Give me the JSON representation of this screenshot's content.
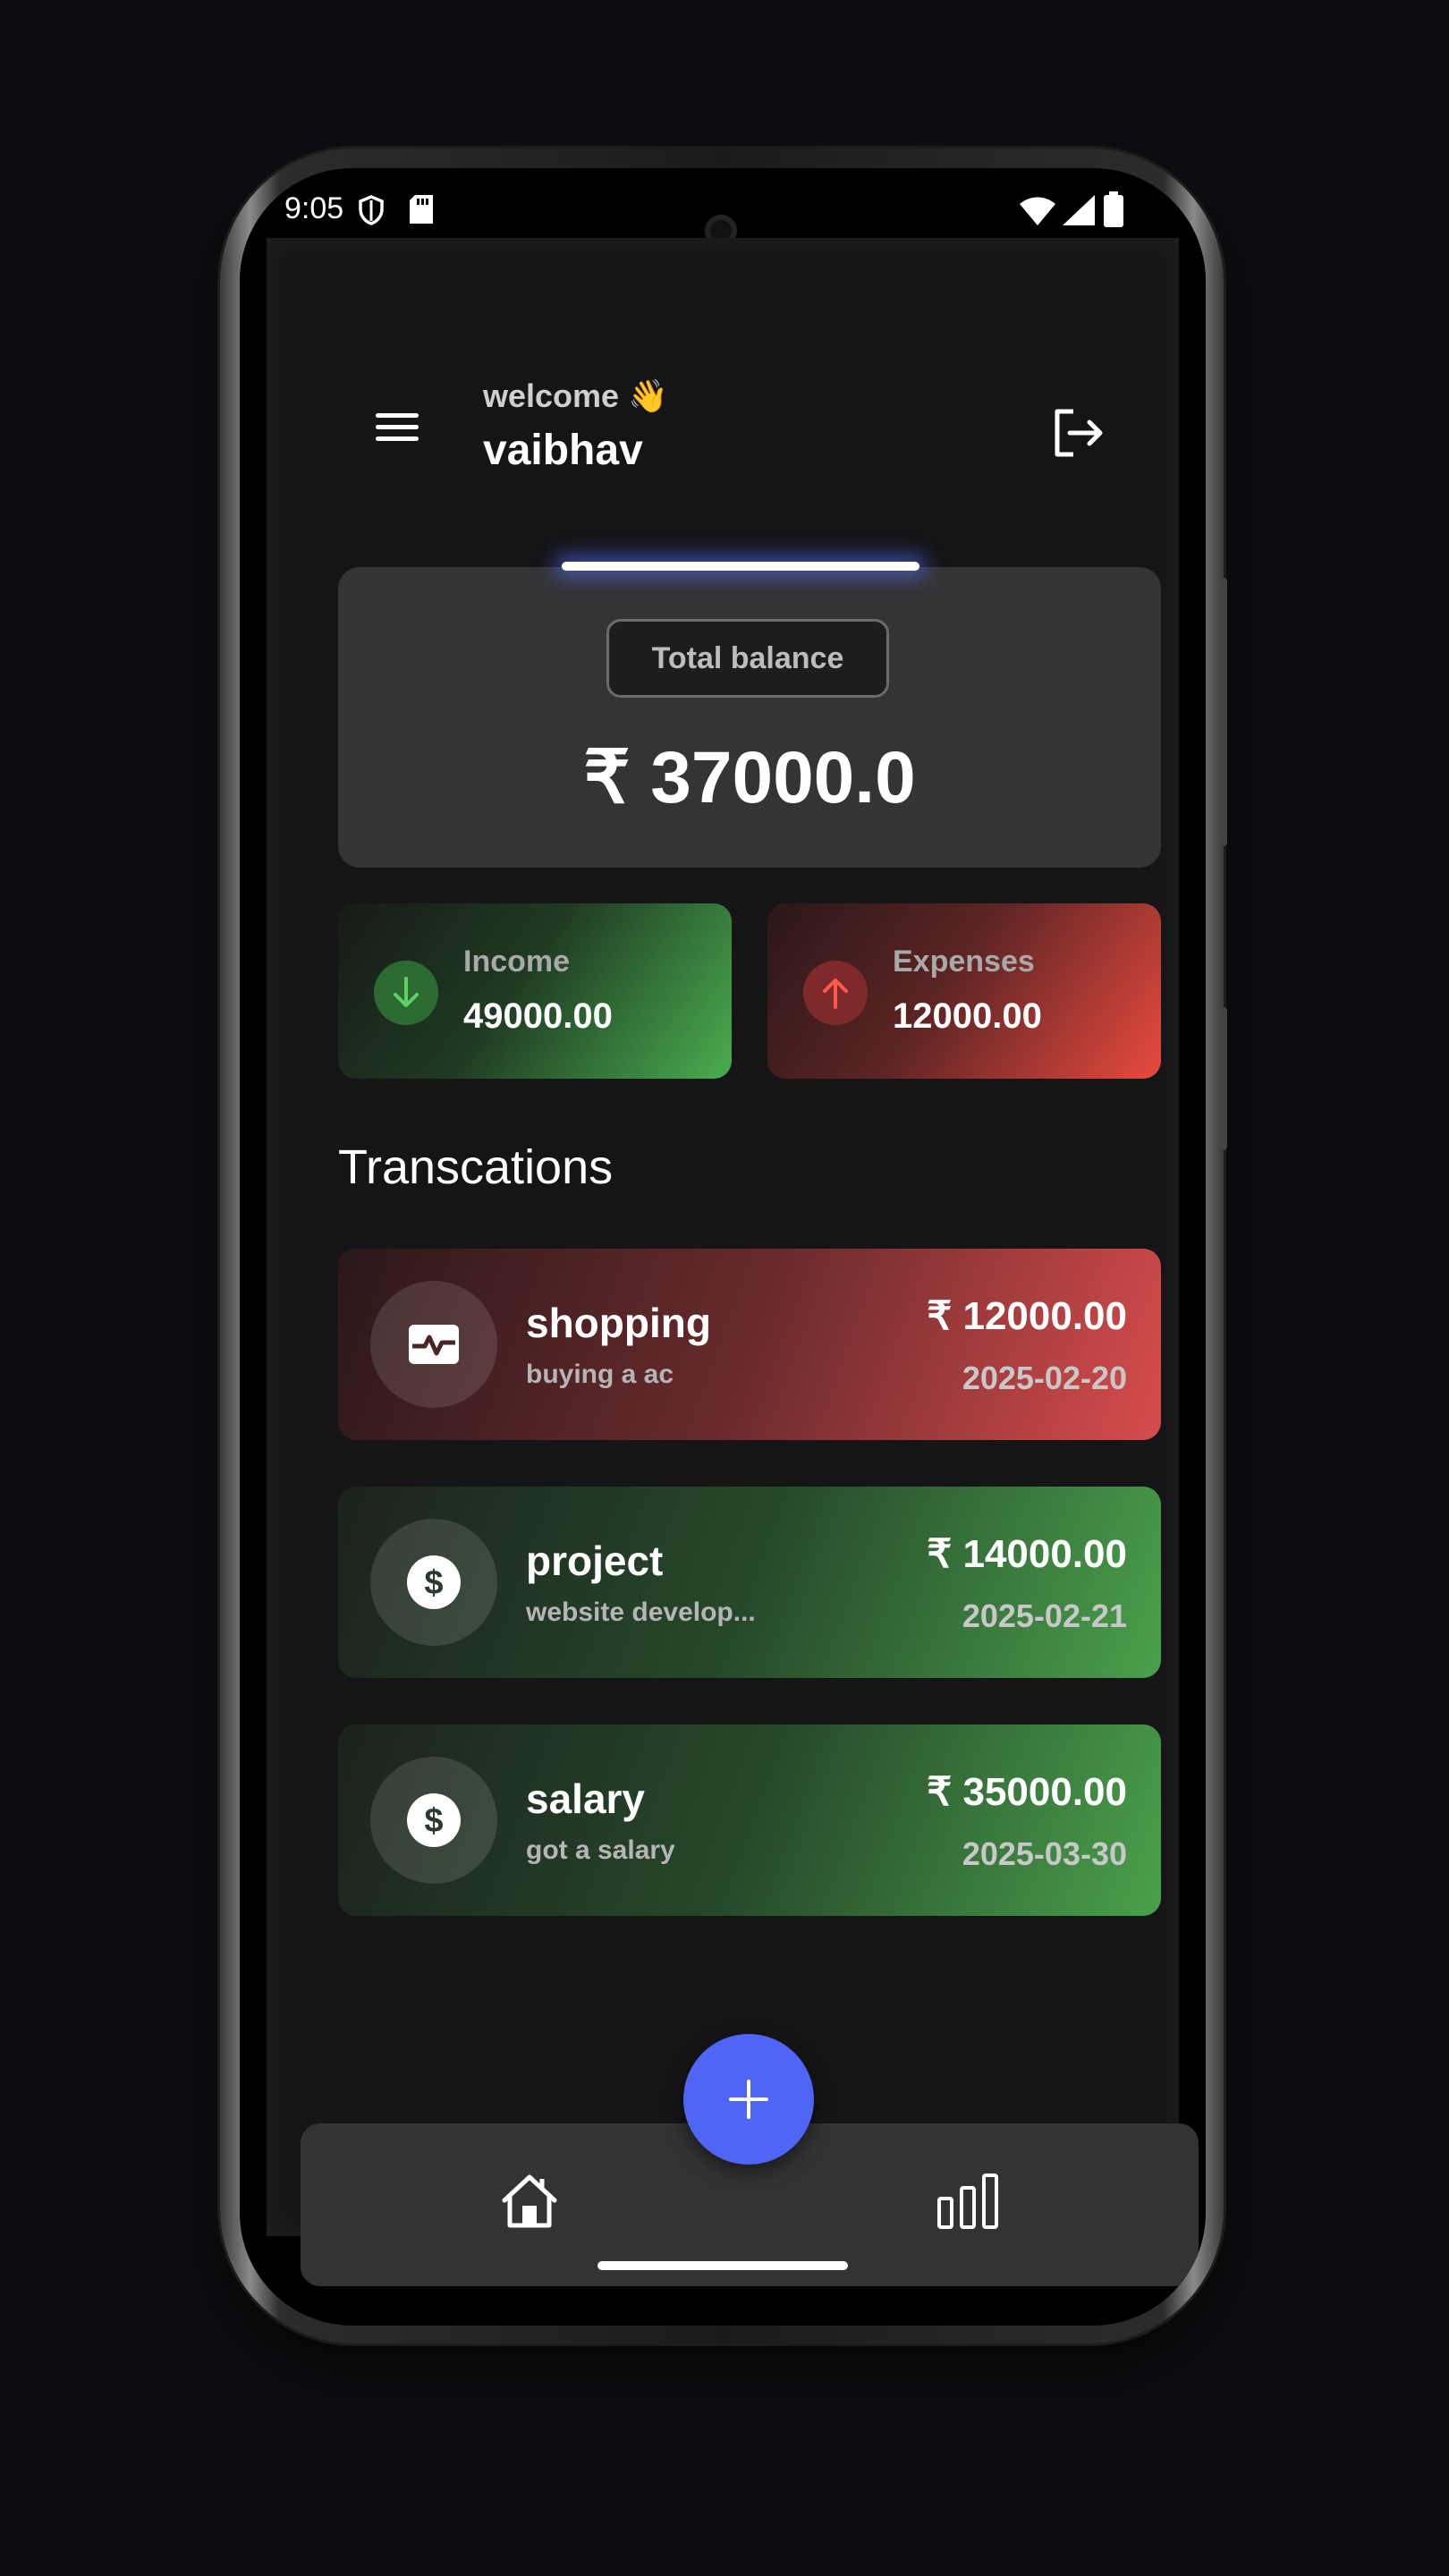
{
  "status_bar": {
    "time": "9:05"
  },
  "header": {
    "welcome": "welcome 👋",
    "username": "vaibhav"
  },
  "balance": {
    "label": "Total balance",
    "amount": "₹ 37000.0"
  },
  "summary": {
    "income": {
      "label": "Income",
      "value": "49000.00"
    },
    "expenses": {
      "label": "Expenses",
      "value": "12000.00"
    }
  },
  "transactions_title": "Transcations",
  "transactions": [
    {
      "name": "shopping",
      "description": "buying  a ac",
      "amount": "₹ 12000.00",
      "date": "2025-02-20",
      "icon": "activity-card-icon",
      "type": "expense"
    },
    {
      "name": "project",
      "description": "website develop...",
      "amount": "₹ 14000.00",
      "date": "2025-02-21",
      "icon": "dollar-coin-icon",
      "type": "income"
    },
    {
      "name": "salary",
      "description": "got a salary",
      "amount": "₹ 35000.00",
      "date": "2025-03-30",
      "icon": "dollar-coin-icon",
      "type": "income"
    }
  ],
  "colors": {
    "background": "#151517",
    "card": "#343436",
    "income_green": "#4aad50",
    "expense_red": "#e84a3f",
    "fab_blue": "#4f65f6"
  }
}
